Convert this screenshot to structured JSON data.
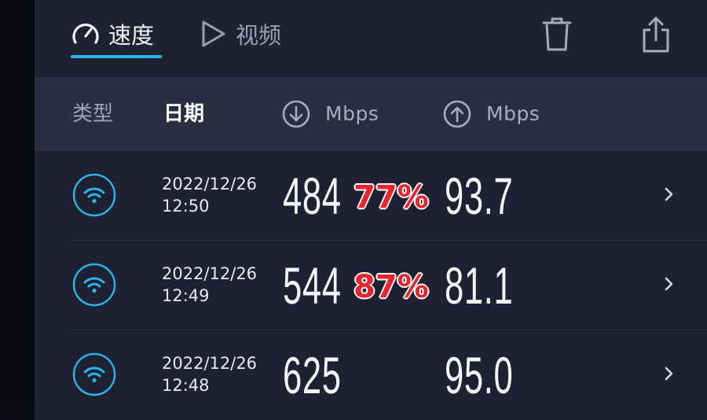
{
  "tabs": [
    {
      "label": "速度",
      "icon": "speedometer-icon",
      "active": true
    },
    {
      "label": "视频",
      "icon": "play-icon",
      "active": false
    }
  ],
  "toolbar": {
    "delete_icon": "trash-icon",
    "share_icon": "share-icon"
  },
  "header": {
    "type_label": "类型",
    "date_label": "日期",
    "download_unit": "Mbps",
    "upload_unit": "Mbps"
  },
  "rows": [
    {
      "date": "2022/12/26",
      "time": "12:50",
      "download": "484",
      "upload": "93.7",
      "percent": "77%"
    },
    {
      "date": "2022/12/26",
      "time": "12:49",
      "download": "544",
      "upload": "81.1",
      "percent": "87%"
    },
    {
      "date": "2022/12/26",
      "time": "12:48",
      "download": "625",
      "upload": "95.0",
      "percent": ""
    }
  ],
  "colors": {
    "accent": "#29b6e8",
    "background": "#1f2233",
    "header_background": "#2a2e40",
    "percent_text": "#e8252f"
  }
}
